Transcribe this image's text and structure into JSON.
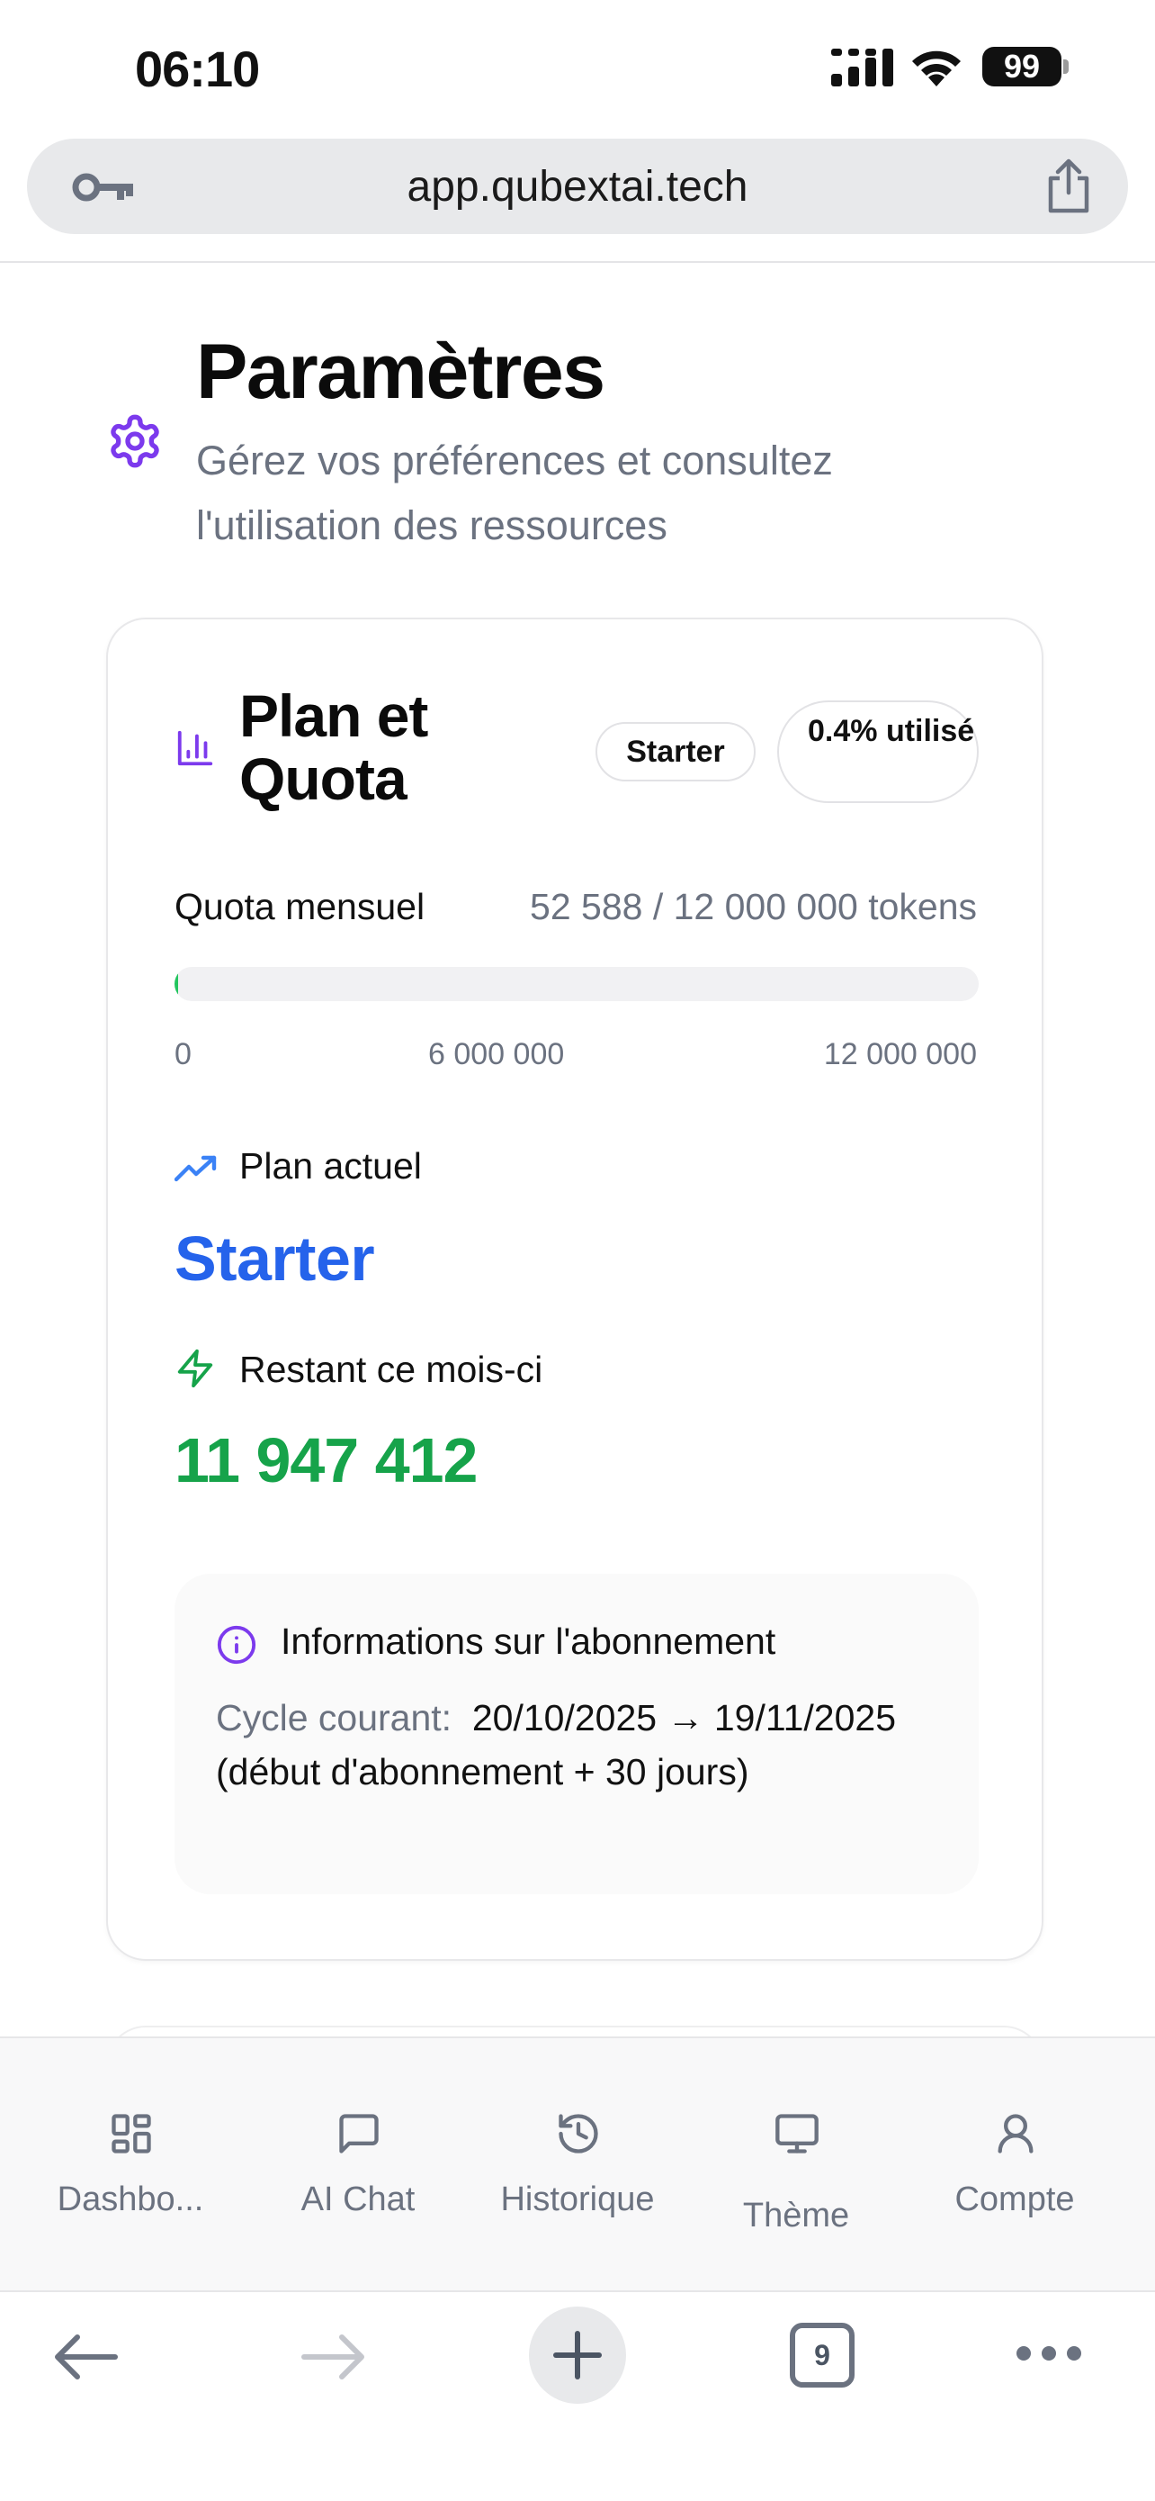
{
  "status_bar": {
    "time": "06:10",
    "battery": "99"
  },
  "browser": {
    "url": "app.qubextai.tech",
    "tab_count": "9"
  },
  "header": {
    "title": "Paramètres",
    "subtitle": "Gérez vos préférences et consultez l'utilisation des ressources"
  },
  "plan_card": {
    "title": "Plan et Quota",
    "badge_plan": "Starter",
    "badge_usage": "0.4% utilisé",
    "quota_label": "Quota mensuel",
    "quota_value": "52 588 / 12 000 000 tokens",
    "progress_fraction": 0.0044,
    "scale": {
      "min": "0",
      "mid": "6 000 000",
      "max": "12 000 000"
    },
    "plan_label": "Plan actuel",
    "plan_value": "Starter",
    "remaining_label": "Restant ce mois-ci",
    "remaining_value": "11 947 412",
    "info": {
      "title": "Informations sur l'abonnement",
      "cycle_label": "Cycle courant:",
      "cycle_value": "20/10/2025 → 19/11/2025 (début d'abonnement + 30 jours)"
    }
  },
  "nav": [
    {
      "label": "Dashbo...",
      "icon": "grid-icon"
    },
    {
      "label": "AI Chat",
      "icon": "chat-icon"
    },
    {
      "label": "Historique",
      "icon": "history-icon"
    },
    {
      "label": "Thème",
      "icon": "monitor-icon"
    },
    {
      "label": "Compte",
      "icon": "user-icon"
    }
  ],
  "colors": {
    "accent_purple": "#7c3aed",
    "plan_blue": "#2563eb",
    "remaining_green": "#16a34a",
    "progress_green": "#22c55e"
  }
}
